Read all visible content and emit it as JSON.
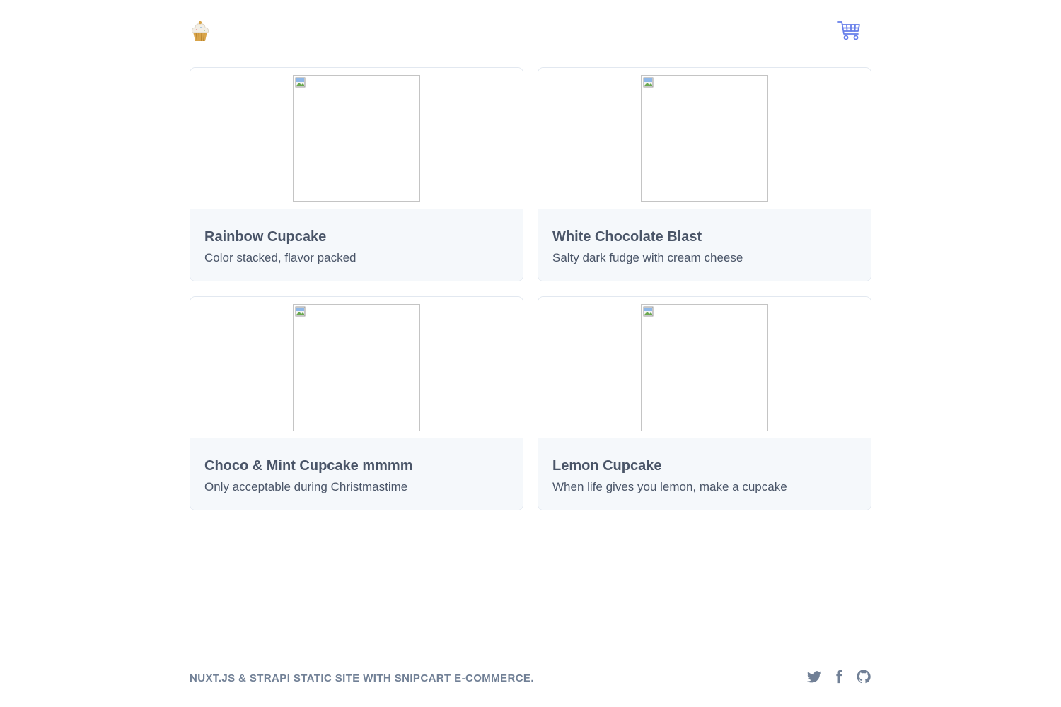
{
  "header": {
    "logo_icon": "cupcake-icon",
    "cart_icon": "shopping-cart-icon",
    "accent": "#667eea"
  },
  "products": [
    {
      "title": "Rainbow Cupcake",
      "description": "Color stacked, flavor packed"
    },
    {
      "title": "White Chocolate Blast",
      "description": "Salty dark fudge with cream cheese"
    },
    {
      "title": "Choco & Mint Cupcake mmmm",
      "description": "Only acceptable during Christmastime"
    },
    {
      "title": "Lemon Cupcake",
      "description": "When life gives you lemon, make a cupcake"
    }
  ],
  "footer": {
    "text": "NUXT.JS & STRAPI STATIC SITE WITH SNIPCART E-COMMERCE.",
    "social": [
      "twitter-icon",
      "facebook-icon",
      "github-icon"
    ],
    "color": "#718096"
  }
}
